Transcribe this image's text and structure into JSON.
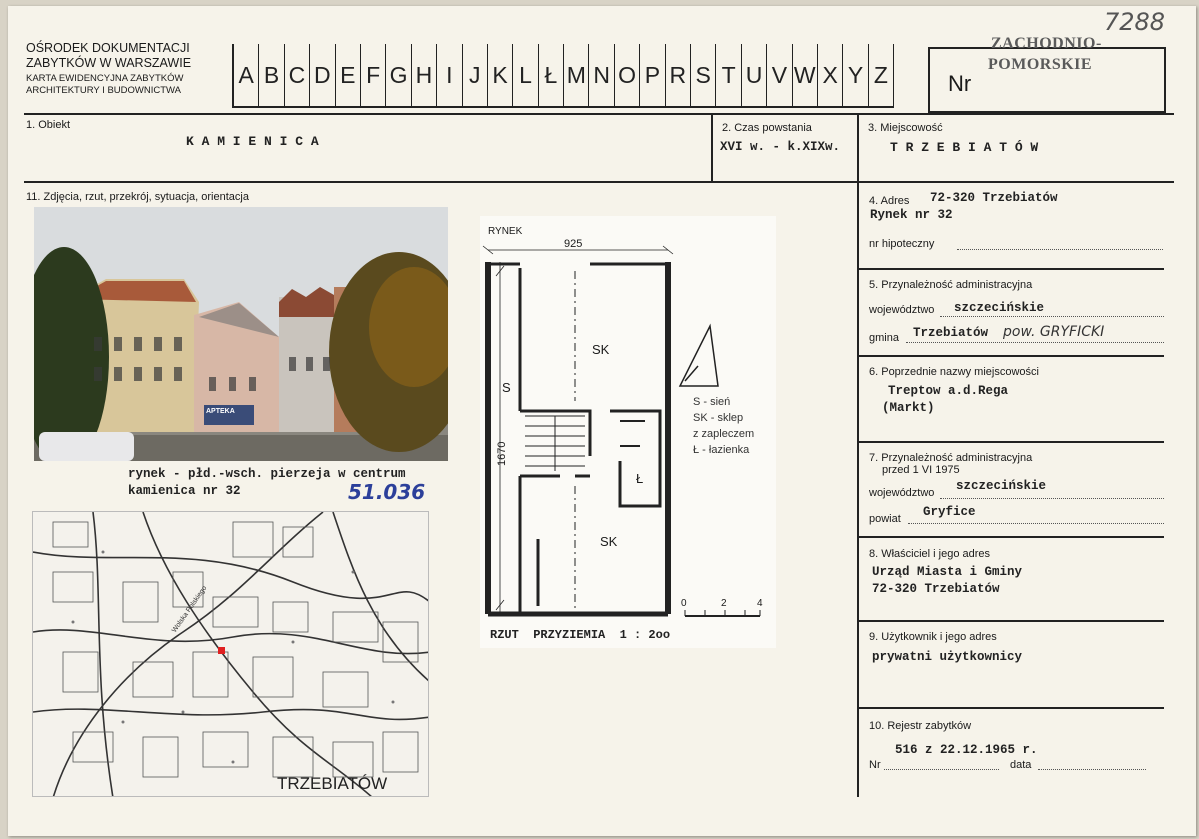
{
  "header": {
    "institution_line1": "OŚRODEK DOKUMENTACJI",
    "institution_line2": "ZABYTKÓW W WARSZAWIE",
    "card_line1": "KARTA EWIDENCYJNA ZABYTKÓW",
    "card_line2": "ARCHITEKTURY I BUDOWNICTWA",
    "letters": [
      "A",
      "B",
      "C",
      "D",
      "E",
      "F",
      "G",
      "H",
      "I",
      "J",
      "K",
      "L",
      "Ł",
      "M",
      "N",
      "O",
      "P",
      "R",
      "S",
      "T",
      "U",
      "V",
      "W",
      "X",
      "Y",
      "Z"
    ],
    "nr_label": "Nr",
    "stamp_line1": "ZACHODNIO-",
    "stamp_line2": "POMORSKIE",
    "handwritten_number": "7288"
  },
  "fields": {
    "obiekt_label": "1. Obiekt",
    "obiekt_value": "K A M I E N I C A",
    "czas_label": "2. Czas powstania",
    "czas_value": "XVI w. - k.XIXw.",
    "miejscowosc_label": "3. Miejscowość",
    "miejscowosc_value": "T R Z E B I A T Ó W",
    "adres_label": "4. Adres",
    "adres_line1": "72-320 Trzebiatów",
    "adres_line2": "Rynek nr 32",
    "hipoteczny_label": "nr hipoteczny",
    "admin_label": "5. Przynależność administracyjna",
    "woj_label": "województwo",
    "woj_value": "szczecińskie",
    "gmina_label": "gmina",
    "gmina_value": "Trzebiatów",
    "gmina_handwritten": "pow. GRYFICKI",
    "poprz_label": "6. Poprzednie nazwy miejscowości",
    "poprz_line1": "Treptow a.d.Rega",
    "poprz_line2": "(Markt)",
    "admin75_label_line1": "7. Przynależność administracyjna",
    "admin75_label_line2": "przed 1 VI 1975",
    "woj75_label": "województwo",
    "woj75_value": "szczecińskie",
    "powiat_label": "powiat",
    "powiat_value": "Gryfice",
    "wlasciciel_label": "8. Właściciel i jego adres",
    "wlasciciel_line1": "Urząd Miasta i Gminy",
    "wlasciciel_line2": "72-320 Trzebiatów",
    "uzytkownik_label": "9. Użytkownik i jego adres",
    "uzytkownik_value": "prywatni użytkownicy",
    "rejestr_label": "10. Rejestr zabytków",
    "rejestr_value": "516 z 22.12.1965 r.",
    "nr_label": "Nr",
    "data_label": "data"
  },
  "photos": {
    "section_label": "11. Zdjęcia, rzut, przekrój, sytuacja, orientacja",
    "caption_line1": "rynek - płd.-wsch. pierzeja w centrum",
    "caption_line2": "kamienica nr 32",
    "handwritten_code": "51.036",
    "shop_sign": "APTEKA",
    "map_town": "TRZEBIATÓW",
    "map_street": "Wolska Polskiego"
  },
  "plan": {
    "rynek": "RYNEK",
    "width_dim": "925",
    "depth_dim": "1670",
    "room_s": "S",
    "room_sk1": "SK",
    "room_sk2": "SK",
    "room_l": "Ł",
    "legend": [
      "S - sień",
      "SK - sklep",
      "z zapleczem",
      "Ł - łazienka"
    ],
    "scale_ticks": [
      "0",
      "2",
      "4"
    ],
    "title": "RZUT  PRZYZIEMIA  1 : 2oo"
  },
  "colors": {
    "paper": "#f6f3ea",
    "ink": "#222222",
    "handwriting": "#2c3f9a",
    "map_marker": "#e02020"
  }
}
